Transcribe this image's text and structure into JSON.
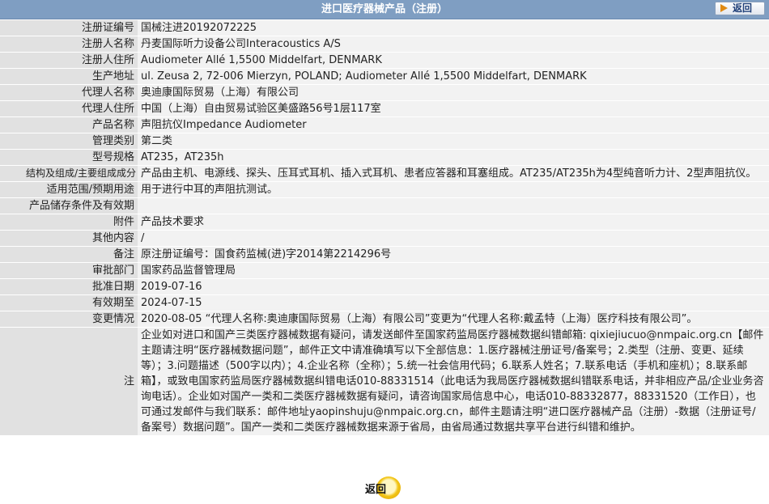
{
  "header": {
    "title": "进口医疗器械产品（注册）",
    "back_label": "返回"
  },
  "rows": [
    {
      "label": "注册证编号",
      "value": "国械注进20192072225"
    },
    {
      "label": "注册人名称",
      "value": "丹麦国际听力设备公司Interacoustics A/S"
    },
    {
      "label": "注册人住所",
      "value": "Audiometer Allé 1,5500 Middelfart, DENMARK"
    },
    {
      "label": "生产地址",
      "value": "ul. Zeusa 2, 72-006 Mierzyn, POLAND; Audiometer Allé 1,5500 Middelfart, DENMARK"
    },
    {
      "label": "代理人名称",
      "value": "奥迪康国际贸易（上海）有限公司"
    },
    {
      "label": "代理人住所",
      "value": "中国（上海）自由贸易试验区美盛路56号1层117室"
    },
    {
      "label": "产品名称",
      "value": "声阻抗仪Impedance Audiometer"
    },
    {
      "label": "管理类别",
      "value": "第二类"
    },
    {
      "label": "型号规格",
      "value": "AT235，AT235h"
    },
    {
      "label": "结构及组成/主要组成成分",
      "value": "产品由主机、电源线、探头、压耳式耳机、插入式耳机、患者应答器和耳塞组成。AT235/AT235h为4型纯音听力计、2型声阻抗仪。"
    },
    {
      "label": "适用范围/预期用途",
      "value": "用于进行中耳的声阻抗测试。"
    },
    {
      "label": "产品储存条件及有效期",
      "value": ""
    },
    {
      "label": "附件",
      "value": "产品技术要求"
    },
    {
      "label": "其他内容",
      "value": "/"
    },
    {
      "label": "备注",
      "value": "原注册证编号：国食药监械(进)字2014第2214296号"
    },
    {
      "label": "审批部门",
      "value": "国家药品监督管理局"
    },
    {
      "label": "批准日期",
      "value": "2019-07-16"
    },
    {
      "label": "有效期至",
      "value": "2024-07-15"
    },
    {
      "label": "变更情况",
      "value": "2020-08-05 “代理人名称:奥迪康国际贸易（上海）有限公司”变更为“代理人名称:戴孟特（上海）医疗科技有限公司”。"
    }
  ],
  "note": {
    "label": "注",
    "value": "企业如对进口和国产三类医疗器械数据有疑问，请发送邮件至国家药监局医疗器械数据纠错邮箱: qixiejiucuo@nmpaic.org.cn【邮件主题请注明“医疗器械数据问题”，邮件正文中请准确填写以下全部信息：1.医疗器械注册证号/备案号；2.类型（注册、变更、延续等）；3.问题描述（500字以内）；4.企业名称（全称）；5.统一社会信用代码；6.联系人姓名；7.联系电话（手机和座机）；8.联系邮箱】，或致电国家药监局医疗器械数据纠错电话010-88331514（此电话为我局医疗器械数据纠错联系电话，并非相应产品/企业业务咨询电话）。企业如对国产一类和二类医疗器械数据有疑问，请咨询国家局信息中心，电话010-88332877，88331520（工作日），也可通过发邮件与我们联系：邮件地址yaopinshuju@nmpaic.org.cn，邮件主题请注明“进口医疗器械产品（注册）-数据（注册证号/备案号）数据问题”。国产一类和二类医疗器械数据来源于省局，由省局通过数据共享平台进行纠错和维护。"
  },
  "footer": {
    "back_label": "返回"
  }
}
